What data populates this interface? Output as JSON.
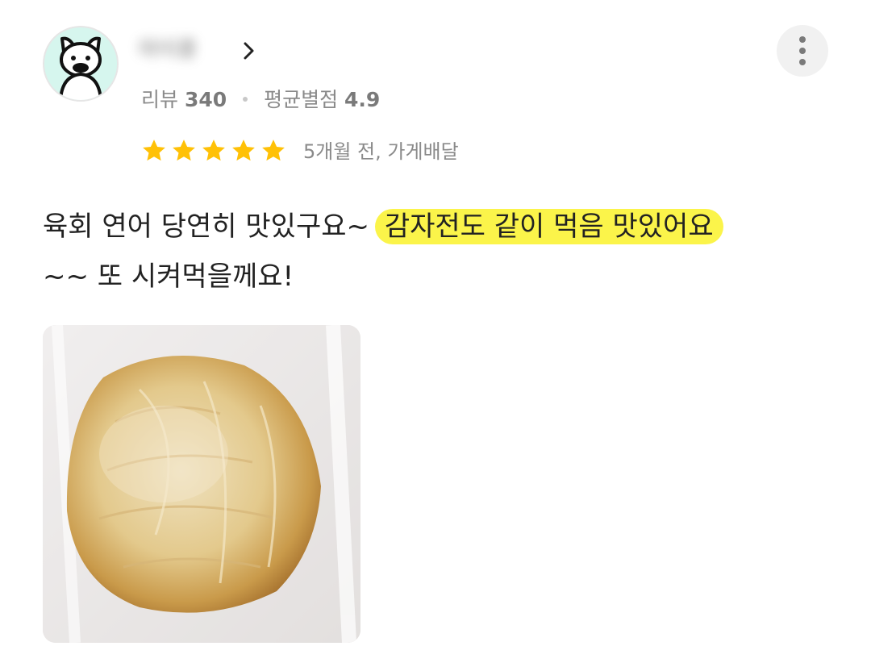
{
  "reviewer": {
    "nickname": "마이콩",
    "review_count_label": "리뷰",
    "review_count": "340",
    "avg_rating_label": "평균별점",
    "avg_rating": "4.9"
  },
  "review": {
    "stars": 5,
    "date_and_type": "5개월 전, 가게배달",
    "text_before": "육회 연어 당연히 맛있구요~ ",
    "text_highlight": "감자전도 같이 먹음 맛있어요",
    "text_after": "~~ 또 시켜먹을께요!"
  },
  "icons": {
    "avatar": "pig-avatar-icon",
    "chevron": "chevron-right-icon",
    "more": "more-vertical-icon",
    "star": "star-icon"
  },
  "colors": {
    "star": "#FFC107",
    "highlight": "#FBF44A",
    "avatar_bg": "#D6F6EE"
  }
}
